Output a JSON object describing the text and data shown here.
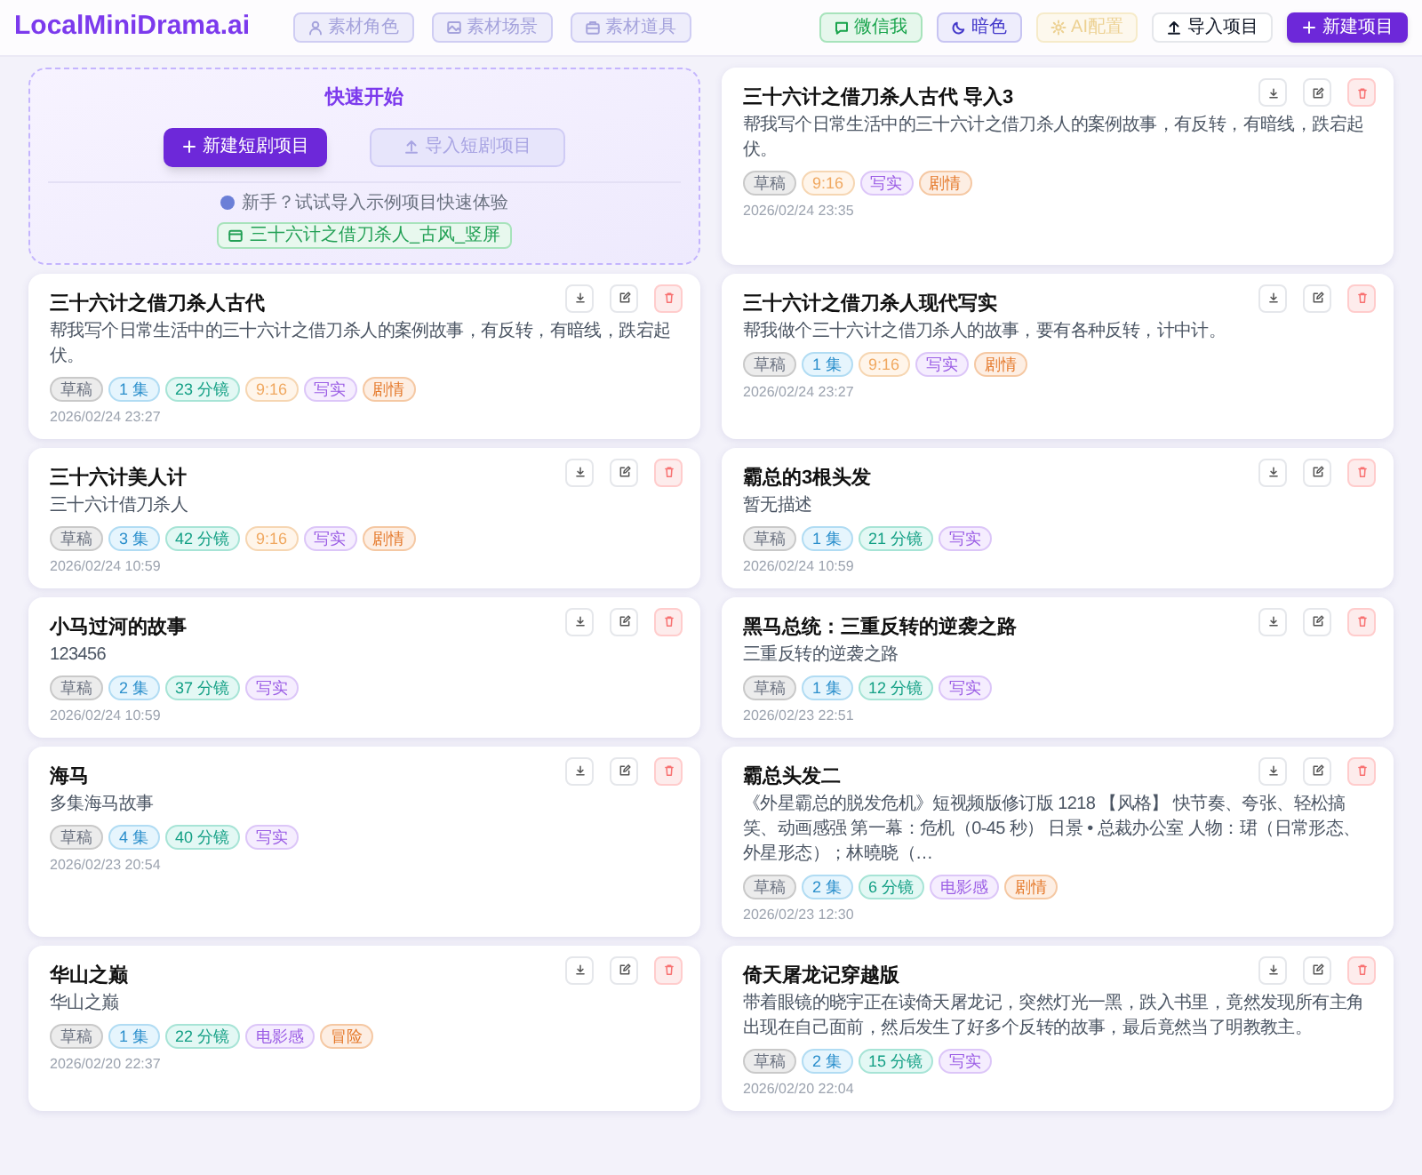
{
  "header": {
    "logo": "LocalMiniDrama.ai",
    "nav": [
      {
        "label": "素材角色",
        "disabled": true
      },
      {
        "label": "素材场景",
        "disabled": true
      },
      {
        "label": "素材道具",
        "disabled": true
      }
    ],
    "actions": [
      {
        "label": "微信我",
        "kind": "wechat",
        "disabled": false
      },
      {
        "label": "暗色",
        "kind": "theme",
        "disabled": false
      },
      {
        "label": "AI配置",
        "kind": "ai",
        "disabled": true
      },
      {
        "label": "导入项目",
        "kind": "import",
        "disabled": false
      },
      {
        "label": "新建项目",
        "kind": "primary",
        "disabled": false
      }
    ]
  },
  "quick_start": {
    "title": "快速开始",
    "new_button": "新建短剧项目",
    "import_button": {
      "label": "导入短剧项目",
      "disabled": true
    },
    "hint": "新手？试试导入示例项目快速体验",
    "sample": "三十六计之借刀杀人_古风_竖屏"
  },
  "projects": [
    {
      "title": "三十六计之借刀杀人古代 导入3",
      "description": "帮我写个日常生活中的三十六计之借刀杀人的案例故事，有反转，有暗线，跌宕起伏。",
      "tags": [
        {
          "kind": "status",
          "text": "草稿"
        },
        {
          "kind": "ratio",
          "text": "9:16"
        },
        {
          "kind": "style",
          "text": "写实"
        },
        {
          "kind": "genre",
          "text": "剧情"
        }
      ],
      "date": "2026/02/24 23:35"
    },
    {
      "title": "三十六计之借刀杀人古代",
      "description": "帮我写个日常生活中的三十六计之借刀杀人的案例故事，有反转，有暗线，跌宕起伏。",
      "tags": [
        {
          "kind": "status",
          "text": "草稿"
        },
        {
          "kind": "episodes",
          "text": "1 集"
        },
        {
          "kind": "shots",
          "text": "23 分镜"
        },
        {
          "kind": "ratio",
          "text": "9:16"
        },
        {
          "kind": "style",
          "text": "写实"
        },
        {
          "kind": "genre",
          "text": "剧情"
        }
      ],
      "date": "2026/02/24 23:27"
    },
    {
      "title": "三十六计之借刀杀人现代写实",
      "description": "帮我做个三十六计之借刀杀人的故事，要有各种反转，计中计。",
      "tags": [
        {
          "kind": "status",
          "text": "草稿"
        },
        {
          "kind": "episodes",
          "text": "1 集"
        },
        {
          "kind": "ratio",
          "text": "9:16"
        },
        {
          "kind": "style",
          "text": "写实"
        },
        {
          "kind": "genre",
          "text": "剧情"
        }
      ],
      "date": "2026/02/24 23:27"
    },
    {
      "title": "三十六计美人计",
      "description": "三十六计借刀杀人",
      "tags": [
        {
          "kind": "status",
          "text": "草稿"
        },
        {
          "kind": "episodes",
          "text": "3 集"
        },
        {
          "kind": "shots",
          "text": "42 分镜"
        },
        {
          "kind": "ratio",
          "text": "9:16"
        },
        {
          "kind": "style",
          "text": "写实"
        },
        {
          "kind": "genre",
          "text": "剧情"
        }
      ],
      "date": "2026/02/24 10:59"
    },
    {
      "title": "霸总的3根头发",
      "description": "暂无描述",
      "tags": [
        {
          "kind": "status",
          "text": "草稿"
        },
        {
          "kind": "episodes",
          "text": "1 集"
        },
        {
          "kind": "shots",
          "text": "21 分镜"
        },
        {
          "kind": "style",
          "text": "写实"
        }
      ],
      "date": "2026/02/24 10:59"
    },
    {
      "title": "小马过河的故事",
      "description": "123456",
      "tags": [
        {
          "kind": "status",
          "text": "草稿"
        },
        {
          "kind": "episodes",
          "text": "2 集"
        },
        {
          "kind": "shots",
          "text": "37 分镜"
        },
        {
          "kind": "style",
          "text": "写实"
        }
      ],
      "date": "2026/02/24 10:59"
    },
    {
      "title": "黑马总统：三重反转的逆袭之路",
      "description": "三重反转的逆袭之路",
      "tags": [
        {
          "kind": "status",
          "text": "草稿"
        },
        {
          "kind": "episodes",
          "text": "1 集"
        },
        {
          "kind": "shots",
          "text": "12 分镜"
        },
        {
          "kind": "style",
          "text": "写实"
        }
      ],
      "date": "2026/02/23 22:51"
    },
    {
      "title": "海马",
      "description": "多集海马故事",
      "tags": [
        {
          "kind": "status",
          "text": "草稿"
        },
        {
          "kind": "episodes",
          "text": "4 集"
        },
        {
          "kind": "shots",
          "text": "40 分镜"
        },
        {
          "kind": "style",
          "text": "写实"
        }
      ],
      "date": "2026/02/23 20:54"
    },
    {
      "title": "霸总头发二",
      "description": "《外星霸总的脱发危机》短视频版修订版 1218 【风格】 快节奏、夸张、轻松搞笑、动画感强 第一幕：危机（0-45 秒） 日景 • 总裁办公室 人物：珺（日常形态、外星形态）；林曉晓（…",
      "tags": [
        {
          "kind": "status",
          "text": "草稿"
        },
        {
          "kind": "episodes",
          "text": "2 集"
        },
        {
          "kind": "shots",
          "text": "6 分镜"
        },
        {
          "kind": "style",
          "text": "电影感"
        },
        {
          "kind": "genre",
          "text": "剧情"
        }
      ],
      "date": "2026/02/23 12:30"
    },
    {
      "title": "华山之巅",
      "description": "华山之巅",
      "tags": [
        {
          "kind": "status",
          "text": "草稿"
        },
        {
          "kind": "episodes",
          "text": "1 集"
        },
        {
          "kind": "shots",
          "text": "22 分镜"
        },
        {
          "kind": "style",
          "text": "电影感"
        },
        {
          "kind": "genre",
          "text": "冒险"
        }
      ],
      "date": "2026/02/20 22:37"
    },
    {
      "title": "倚天屠龙记穿越版",
      "description": "带着眼镜的晓宇正在读倚天屠龙记，突然灯光一黑，跌入书里，竟然发现所有主角出现在自己面前，然后发生了好多个反转的故事，最后竟然当了明教教主。",
      "tags": [
        {
          "kind": "status",
          "text": "草稿"
        },
        {
          "kind": "episodes",
          "text": "2 集"
        },
        {
          "kind": "shots",
          "text": "15 分镜"
        },
        {
          "kind": "style",
          "text": "写实"
        }
      ],
      "date": "2026/02/20 22:04"
    }
  ]
}
